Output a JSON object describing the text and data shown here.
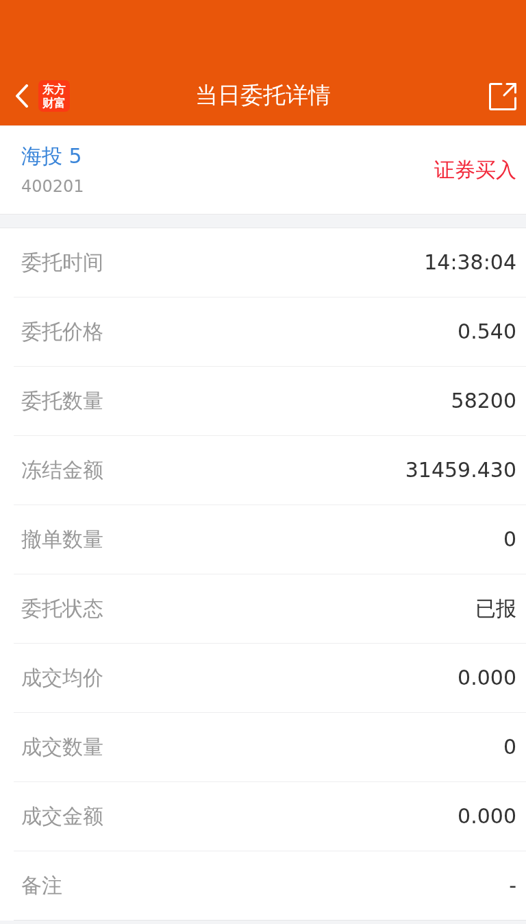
{
  "header": {
    "title": "当日委托详情",
    "logo_text": "东方财富"
  },
  "stock": {
    "name": "海投 5",
    "code": "400201",
    "action": "证券买入"
  },
  "details": [
    {
      "label": "委托时间",
      "value": "14:38:04"
    },
    {
      "label": "委托价格",
      "value": "0.540"
    },
    {
      "label": "委托数量",
      "value": "58200"
    },
    {
      "label": "冻结金额",
      "value": "31459.430"
    },
    {
      "label": "撤单数量",
      "value": "0"
    },
    {
      "label": "委托状态",
      "value": "已报"
    },
    {
      "label": "成交均价",
      "value": "0.000"
    },
    {
      "label": "成交数量",
      "value": "0"
    },
    {
      "label": "成交金额",
      "value": "0.000"
    },
    {
      "label": "备注",
      "value": "-"
    }
  ]
}
